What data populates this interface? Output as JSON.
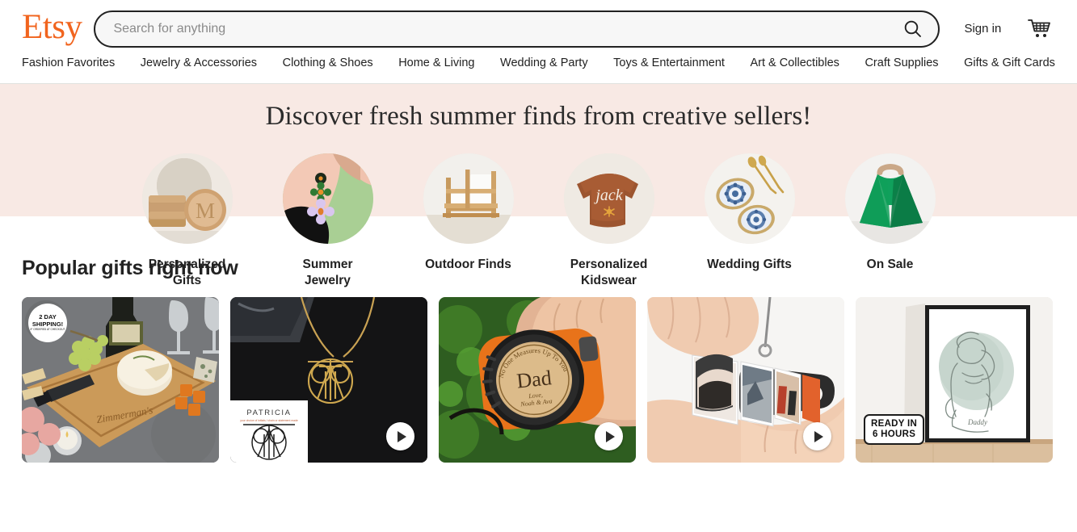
{
  "header": {
    "logo": "Etsy",
    "search": {
      "placeholder": "Search for anything",
      "value": "",
      "icon": "search-icon",
      "button_label": ""
    },
    "signin_label": "Sign in",
    "cart_icon": "shopping-cart-icon"
  },
  "nav": {
    "items": [
      {
        "label": "Fashion Favorites"
      },
      {
        "label": "Jewelry & Accessories"
      },
      {
        "label": "Clothing & Shoes"
      },
      {
        "label": "Home & Living"
      },
      {
        "label": "Wedding & Party"
      },
      {
        "label": "Toys & Entertainment"
      },
      {
        "label": "Art & Collectibles"
      },
      {
        "label": "Craft Supplies"
      },
      {
        "label": "Gifts & Gift Cards"
      }
    ]
  },
  "hero": {
    "title": "Discover fresh summer finds from creative sellers!",
    "background_color": "#f8e9e4"
  },
  "categories": [
    {
      "label": "Personalized Gifts",
      "image": "monogram-coaster-set"
    },
    {
      "label": "Summer Jewelry",
      "image": "flower-earrings-model"
    },
    {
      "label": "Outdoor Finds",
      "image": "wooden-outdoor-chair"
    },
    {
      "label": "Personalized Kidswear",
      "image": "brown-jack-sweater"
    },
    {
      "label": "Wedding Gifts",
      "image": "blue-oyster-trinket-dishes"
    },
    {
      "label": "On Sale",
      "image": "green-knot-bag"
    }
  ],
  "popular": {
    "title": "Popular gifts right now",
    "cards": [
      {
        "name": "personalized-cheese-board",
        "badge_line1": "2 DAY",
        "badge_line2": "SHIPPING!",
        "badge_sub": "IF ORDERED AT CHECKOUT",
        "has_video": false
      },
      {
        "name": "gold-monogram-necklace",
        "inset_label": "PATRICIA",
        "has_video": true
      },
      {
        "name": "engraved-dad-tape-measure",
        "engraving_top": "No One Measures Up To You",
        "engraving_main": "Dad",
        "engraving_sub": "Love, Noah & Ava",
        "has_video": true
      },
      {
        "name": "mini-photo-album-keychain",
        "has_video": true
      },
      {
        "name": "line-art-daddy-print",
        "badge_line1": "READY IN",
        "badge_line2": "6 HOURS",
        "print_caption": "Daddy",
        "has_video": false
      }
    ]
  },
  "colors": {
    "brand_orange": "#f1641e",
    "hero_pink": "#f8e9e4",
    "text": "#222222"
  }
}
